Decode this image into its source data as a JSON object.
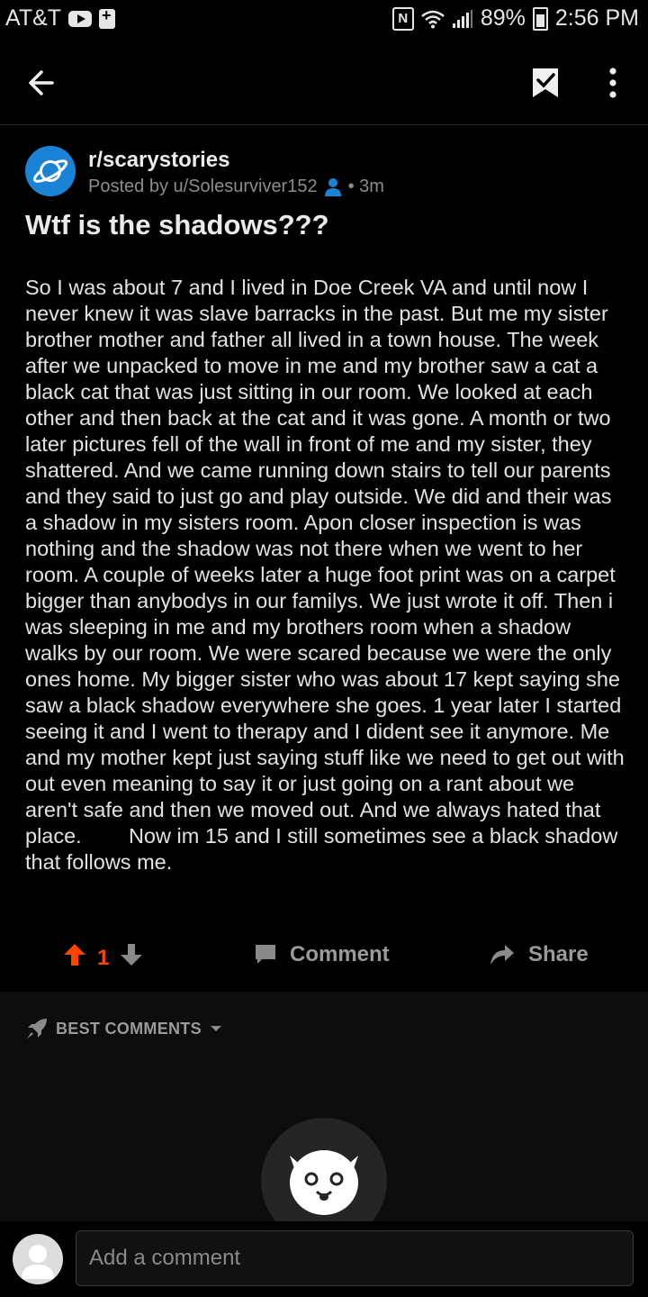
{
  "status_bar": {
    "carrier": "AT&T",
    "nfc": "N",
    "battery": "89%",
    "time": "2:56 PM"
  },
  "icons": {
    "back": "arrow-left-icon",
    "save": "bookmark-check-icon",
    "more": "more-vertical-icon",
    "subreddit": "planet-icon",
    "user": "user-icon",
    "upvote": "arrow-up-icon",
    "downvote": "arrow-down-icon",
    "comment": "comment-bubble-icon",
    "share": "share-arrow-icon",
    "sort": "rocket-icon",
    "dropdown": "caret-down-icon"
  },
  "post": {
    "subreddit": "r/scarystories",
    "posted_by": "Posted by u/Solesurviver152",
    "age": "• 3m",
    "title": "Wtf is the shadows???",
    "body": "So I was about 7 and I lived in Doe Creek VA and until now I never knew it was slave barracks in the past. But me my sister brother mother and father all lived in a town house. The week after we unpacked to move in me and my brother saw a cat a black cat that was just sitting in our room. We looked at each other and then back at the cat and it was gone. A month or two later pictures fell of the wall in front of me and my sister, they shattered. And we came running down stairs to tell our parents and they said to just go and play outside. We did and their was a shadow in my sisters room. Apon closer inspection is was nothing and the shadow was not there when we went to her room. A couple of weeks later a huge foot print was on a carpet bigger than anybodys in our familys. We just wrote it off. Then i was sleeping in me and my brothers room when a shadow walks by our room. We were scared because we were the only ones home. My bigger sister who was about 17 kept saying she saw a black shadow everywhere she goes. 1 year later I started seeing it and I went to therapy and I dident see it anymore. Me and my mother kept just saying stuff like we need to get out with out even meaning to say it or just going on a rant about we aren't safe and then we moved out. And we always hated that place.        Now im 15 and I still sometimes see a black shadow that follows me."
  },
  "actions": {
    "vote_count": "1",
    "comment_label": "Comment",
    "share_label": "Share"
  },
  "comments": {
    "sort_label": "BEST COMMENTS"
  },
  "composer": {
    "placeholder": "Add a comment"
  },
  "colors": {
    "background": "#000000",
    "upvote": "#ff4500",
    "subreddit_icon": "#1b83d6"
  }
}
